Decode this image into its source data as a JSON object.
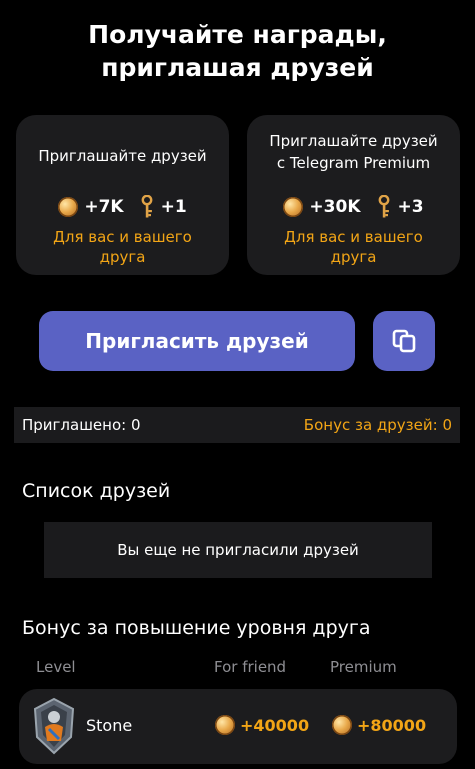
{
  "header": {
    "title_line1": "Получайте награды,",
    "title_line2": "приглашая друзей"
  },
  "cards": [
    {
      "title_line1": "Приглашайте друзей",
      "title_line2": "",
      "coins": "+7K",
      "keys": "+1",
      "sub_line1": "Для вас и вашего",
      "sub_line2": "друга"
    },
    {
      "title_line1": "Приглашайте друзей",
      "title_line2": "с Telegram Premium",
      "coins": "+30K",
      "keys": "+3",
      "sub_line1": "Для вас и вашего",
      "sub_line2": "друга"
    }
  ],
  "actions": {
    "invite_label": "Пригласить друзей",
    "copy_icon": "copy-icon"
  },
  "stats": {
    "invited": "Приглашено: 0",
    "bonus": "Бонус за друзей: 0"
  },
  "friends": {
    "title": "Список друзей",
    "empty": "Вы еще не пригласили друзей"
  },
  "level_bonus": {
    "title": "Бонус за повышение уровня друга",
    "columns": [
      "Level",
      "For friend",
      "Premium"
    ],
    "rows": [
      {
        "name": "Stone",
        "for_friend": "+40000",
        "premium": "+80000"
      }
    ]
  },
  "colors": {
    "accent": "#5a62c4",
    "gold": "#f2a516",
    "card": "#1c1c1e",
    "background": "#000000"
  }
}
